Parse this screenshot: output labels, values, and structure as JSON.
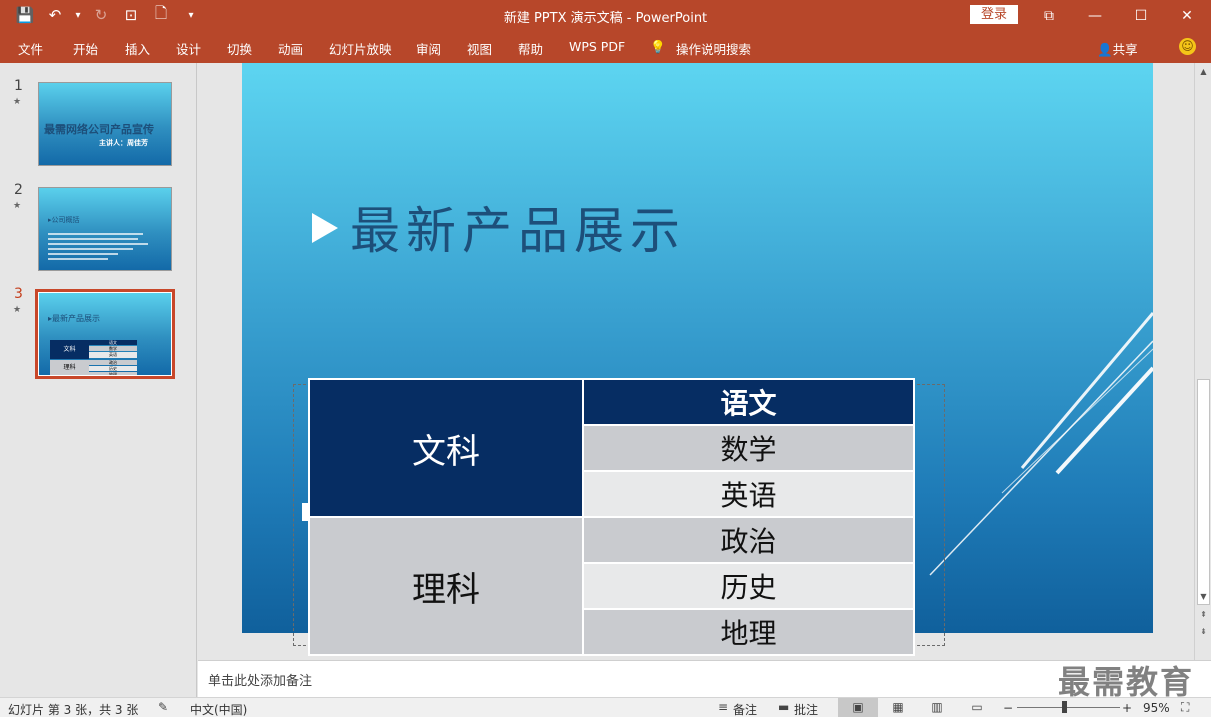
{
  "window": {
    "title": "新建 PPTX 演示文稿  -  PowerPoint",
    "login": "登录",
    "controls": {
      "ribbon_display": "⧉",
      "minimize": "—",
      "maximize": "☐",
      "close": "✕"
    }
  },
  "qat": {
    "save_icon": "💾",
    "undo_icon": "↶",
    "undo_drop": "▾",
    "redo_icon": "↻",
    "present_icon": "⊡",
    "new_icon": "🗋",
    "customize_icon": "▾"
  },
  "tabs": [
    "文件",
    "开始",
    "插入",
    "设计",
    "切换",
    "动画",
    "幻灯片放映",
    "审阅",
    "视图",
    "帮助",
    "WPS PDF"
  ],
  "tell_me": {
    "icon": "💡",
    "label": "操作说明搜索"
  },
  "share": {
    "icon": "👤",
    "label": "共享"
  },
  "smiley": "☺",
  "thumbnails": [
    {
      "num": "1",
      "star": "★",
      "title": "最需网络公司产品宣传",
      "subtitle": "主讲人：周佳芳"
    },
    {
      "num": "2",
      "star": "★",
      "title": "▸公司概括"
    },
    {
      "num": "3",
      "star": "★",
      "title": "▸最新产品展示",
      "cells": [
        "文科",
        "语文",
        "数学",
        "英语",
        "理科",
        "政治",
        "历史",
        "地理"
      ]
    }
  ],
  "slide": {
    "title": "最新产品展示",
    "table": {
      "header": "语文",
      "groups": [
        {
          "name": "文科",
          "items": [
            "数学",
            "英语"
          ]
        },
        {
          "name": "理科",
          "items": [
            "政治",
            "历史",
            "地理"
          ]
        }
      ]
    }
  },
  "notes": {
    "placeholder": "单击此处添加备注",
    "watermark": "最需教育"
  },
  "scroll": {
    "up": "▲",
    "down": "▼",
    "prev": "⇞",
    "next": "⇟"
  },
  "statusbar": {
    "slide_info": "幻灯片 第 3 张，共 3 张",
    "spell_icon": "✎",
    "language": "中文(中国)",
    "notes_label": "备注",
    "comments_label": "批注",
    "notes_icon": "≡",
    "comments_icon": "▬",
    "view_normal": "▣",
    "view_sorter": "▦",
    "view_reading": "▥",
    "view_slideshow": "▭",
    "zoom_minus": "−",
    "zoom_plus": "+",
    "zoom": "95%",
    "fit_icon": "⛶"
  }
}
